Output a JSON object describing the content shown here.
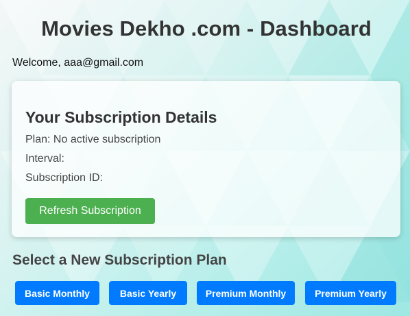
{
  "page": {
    "title": "Movies Dekho .com - Dashboard",
    "welcome": "Welcome, aaa@gmail.com"
  },
  "subscription": {
    "heading": "Your Subscription Details",
    "plan_line": "Plan: No active subscription",
    "interval_line": "Interval:",
    "subscription_id_line": "Subscription ID:",
    "refresh_label": "Refresh Subscription",
    "refresh_color": "#4caf50"
  },
  "plans": {
    "heading": "Select a New Subscription Plan",
    "button_color": "#007bff",
    "items": [
      {
        "label": "Basic Monthly"
      },
      {
        "label": "Basic Yearly"
      },
      {
        "label": "Premium Monthly"
      },
      {
        "label": "Premium Yearly"
      }
    ]
  }
}
